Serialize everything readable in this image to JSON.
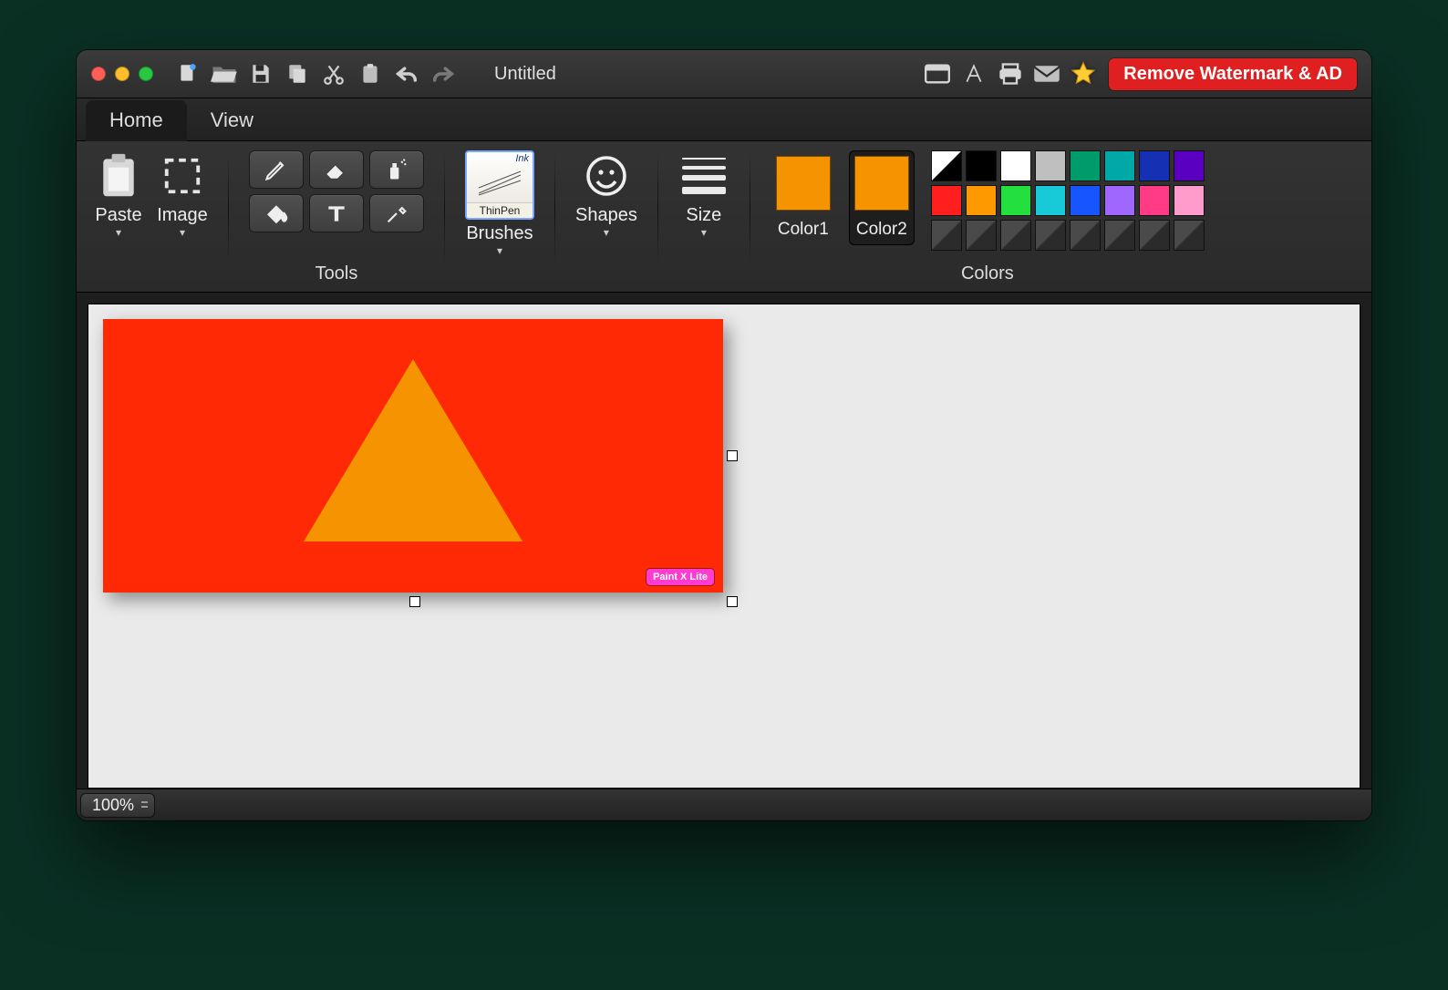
{
  "titlebar": {
    "doc_title": "Untitled",
    "promo": "Remove Watermark & AD"
  },
  "tabs": {
    "home": "Home",
    "view": "View"
  },
  "ribbon": {
    "paste": "Paste",
    "image": "Image",
    "tools_label": "Tools",
    "brushes": "Brushes",
    "brush_ink": "Ink",
    "brush_name": "ThinPen",
    "shapes": "Shapes",
    "size": "Size",
    "color1": "Color1",
    "color2": "Color2",
    "colors_label": "Colors",
    "c1_hex": "#f59300",
    "c2_hex": "#f59300",
    "palette": [
      [
        "split",
        "#000000",
        "#ffffff",
        "#bfbfbf",
        "#009b6b",
        "#00a8a8",
        "#1530b3",
        "#5a00c0"
      ],
      [
        "#ff1f1f",
        "#ff9900",
        "#23e03e",
        "#18c9d8",
        "#1756ff",
        "#a067ff",
        "#ff3b86",
        "#ff9ccc"
      ],
      [
        "empty",
        "empty",
        "empty",
        "empty",
        "empty",
        "empty",
        "empty",
        "empty"
      ]
    ]
  },
  "canvas": {
    "bg": "#ff2a05",
    "shape_color": "#f59300",
    "watermark": "Paint X Lite"
  },
  "status": {
    "zoom": "100%"
  }
}
